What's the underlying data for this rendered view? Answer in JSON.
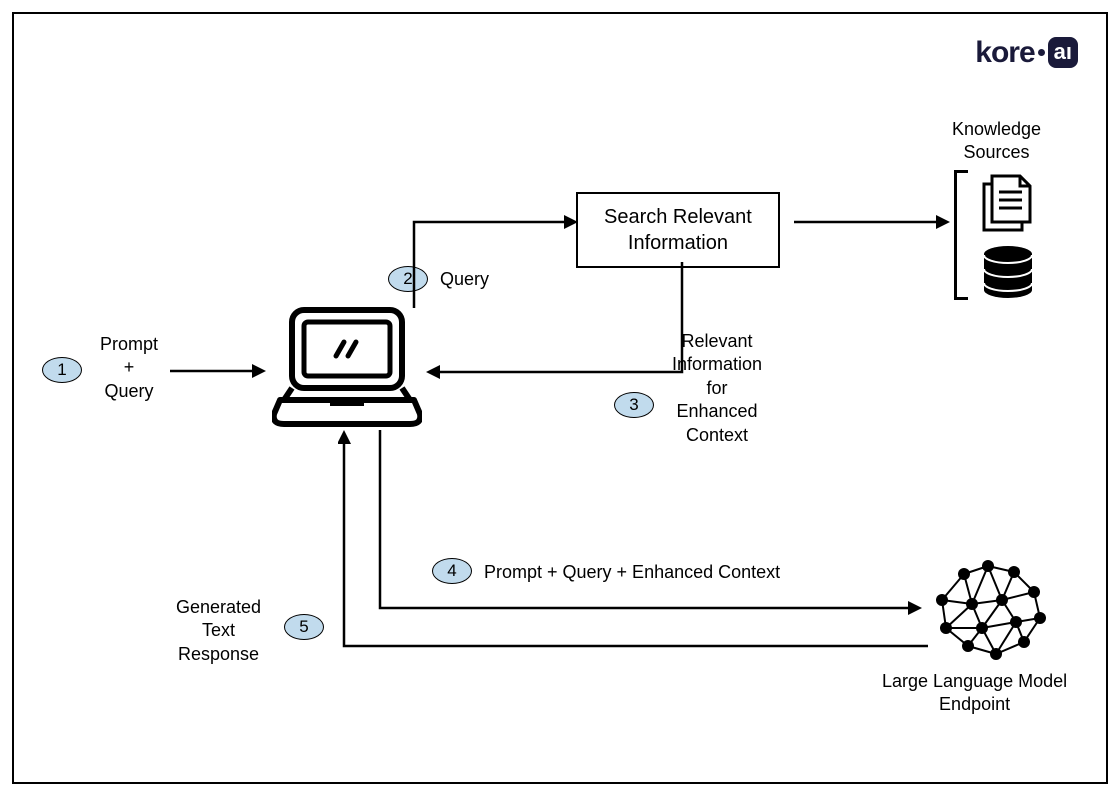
{
  "logo": {
    "brand": "kore",
    "suffix": "aı"
  },
  "nodes": {
    "search_box_line1": "Search Relevant",
    "search_box_line2": "Information",
    "knowledge_sources": "Knowledge\nSources",
    "llm_endpoint": "Large Language Model\nEndpoint"
  },
  "steps": {
    "s1": {
      "num": "1",
      "label": "Prompt\n+\nQuery"
    },
    "s2": {
      "num": "2",
      "label": "Query"
    },
    "s3": {
      "num": "3",
      "label": "Relevant\nInformation\nfor\nEnhanced\nContext"
    },
    "s4": {
      "num": "4",
      "label": "Prompt  + Query + Enhanced Context"
    },
    "s5": {
      "num": "5",
      "label": "Generated\nText\nResponse"
    }
  }
}
